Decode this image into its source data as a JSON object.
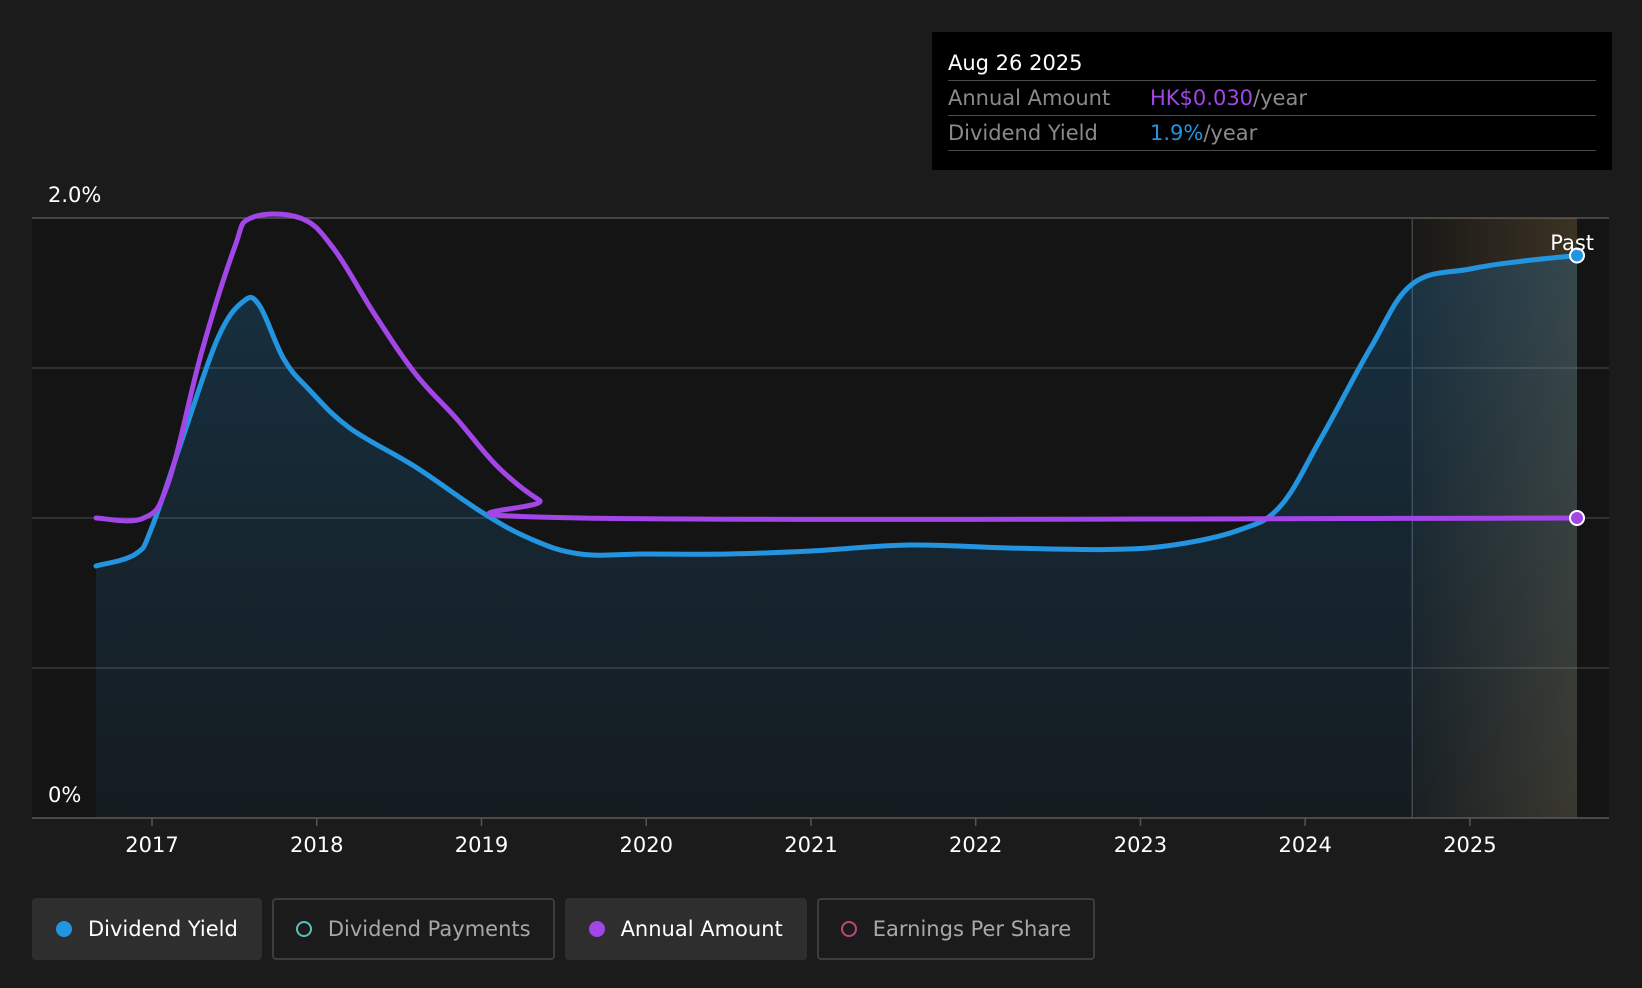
{
  "tooltip": {
    "date": "Aug 26 2025",
    "annual_amount_label": "Annual Amount",
    "annual_amount_value": "HK$0.030",
    "dividend_yield_label": "Dividend Yield",
    "dividend_yield_value": "1.9%",
    "unit": "/year"
  },
  "legend": [
    {
      "label": "Dividend Yield",
      "color": "#2394df",
      "active": true,
      "filled": true
    },
    {
      "label": "Dividend Payments",
      "color": "#58c3b8",
      "active": false,
      "filled": false
    },
    {
      "label": "Annual Amount",
      "color": "#a346e8",
      "active": true,
      "filled": true
    },
    {
      "label": "Earnings Per Share",
      "color": "#b64a80",
      "active": false,
      "filled": false
    }
  ],
  "colors": {
    "dividend_yield": "#2394df",
    "annual_amount": "#a346e8",
    "background": "#1b1b1b",
    "plot_background": "#141414",
    "grid": "#3a3a3a"
  },
  "chart_data": {
    "type": "line",
    "y_tick_labels": [
      "2.0%",
      "0%"
    ],
    "ylim": [
      0,
      2.0
    ],
    "xlim": [
      2016.66,
      2025.65
    ],
    "x_ticks": [
      2017,
      2018,
      2019,
      2020,
      2021,
      2022,
      2023,
      2024,
      2025
    ],
    "x_tick_labels": [
      "2017",
      "2018",
      "2019",
      "2020",
      "2021",
      "2022",
      "2023",
      "2024",
      "2025"
    ],
    "past_label": "Past",
    "past_region_start": 2024.65,
    "grid": true,
    "series": [
      {
        "name": "Dividend Yield",
        "key": "dividend_yield",
        "area": true,
        "points": [
          [
            2016.66,
            0.84
          ],
          [
            2016.9,
            0.88
          ],
          [
            2017.0,
            0.97
          ],
          [
            2017.2,
            1.29
          ],
          [
            2017.4,
            1.6
          ],
          [
            2017.55,
            1.72
          ],
          [
            2017.65,
            1.71
          ],
          [
            2017.8,
            1.53
          ],
          [
            2017.95,
            1.43
          ],
          [
            2018.2,
            1.3
          ],
          [
            2018.6,
            1.17
          ],
          [
            2019.0,
            1.02
          ],
          [
            2019.3,
            0.93
          ],
          [
            2019.6,
            0.88
          ],
          [
            2020.0,
            0.88
          ],
          [
            2020.5,
            0.88
          ],
          [
            2021.0,
            0.89
          ],
          [
            2021.6,
            0.91
          ],
          [
            2022.2,
            0.9
          ],
          [
            2022.8,
            0.895
          ],
          [
            2023.2,
            0.91
          ],
          [
            2023.6,
            0.96
          ],
          [
            2023.85,
            1.04
          ],
          [
            2024.1,
            1.27
          ],
          [
            2024.4,
            1.57
          ],
          [
            2024.65,
            1.78
          ],
          [
            2025.0,
            1.83
          ],
          [
            2025.3,
            1.855
          ],
          [
            2025.65,
            1.875
          ]
        ]
      },
      {
        "name": "Annual Amount",
        "key": "annual_amount",
        "area": false,
        "points": [
          [
            2016.66,
            1.0
          ],
          [
            2016.95,
            1.0
          ],
          [
            2017.1,
            1.12
          ],
          [
            2017.3,
            1.55
          ],
          [
            2017.5,
            1.9
          ],
          [
            2017.6,
            2.0
          ],
          [
            2017.9,
            2.0
          ],
          [
            2018.1,
            1.9
          ],
          [
            2018.35,
            1.68
          ],
          [
            2018.6,
            1.48
          ],
          [
            2018.85,
            1.33
          ],
          [
            2019.1,
            1.17
          ],
          [
            2019.35,
            1.06
          ],
          [
            2019.6,
            1.0
          ],
          [
            2025.65,
            1.0
          ]
        ]
      }
    ]
  }
}
